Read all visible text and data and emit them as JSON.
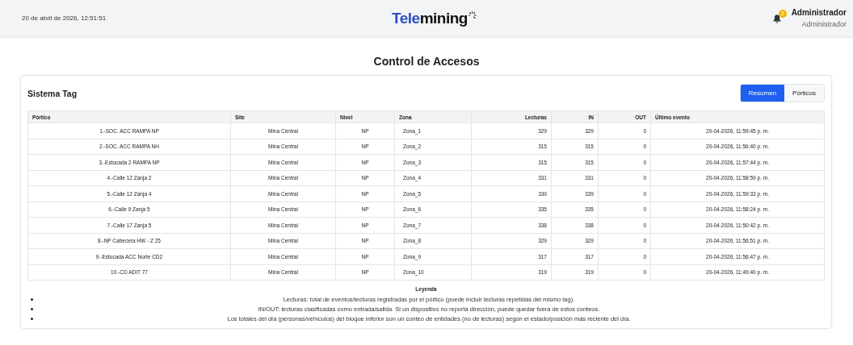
{
  "header": {
    "datetime": "20 de abril de 2026, 12:51:51",
    "logo": {
      "part_1": "Tele",
      "part_2": "mining"
    },
    "notifications": {
      "count": "2"
    },
    "user": {
      "name": "Administrador",
      "role": "Administrador"
    }
  },
  "page_title": "Control de Accesos",
  "card": {
    "title": "Sistema Tag",
    "view_buttons": [
      {
        "label": "Resumen",
        "selected": true
      },
      {
        "label": "Pórticos",
        "selected": false
      }
    ],
    "table": {
      "columns": [
        "Pórtico",
        "Site",
        "Nivel",
        "Zona",
        "Lecturas",
        "IN",
        "OUT",
        "Último evento"
      ],
      "rows": [
        [
          "1.-SOC. ACC RAMPA NP",
          "Mina Central",
          "NP",
          "Zona_1",
          "329",
          "329",
          "0",
          "20-04-2026, 11:59:45 p. m."
        ],
        [
          "2.-SOC. ACC RAMPA NH",
          "Mina Central",
          "NP",
          "Zona_2",
          "315",
          "315",
          "0",
          "20-04-2026, 11:56:40 p. m."
        ],
        [
          "3.-Estocada 2 RAMPA NP",
          "Mina Central",
          "NP",
          "Zona_3",
          "315",
          "315",
          "0",
          "20-04-2026, 11:57:44 p. m."
        ],
        [
          "4.-Calle 12 Zanja 2",
          "Mina Central",
          "NP",
          "Zona_4",
          "331",
          "331",
          "0",
          "20-04-2026, 11:58:59 p. m."
        ],
        [
          "5.-Calle 12 Zanja 4",
          "Mina Central",
          "NP",
          "Zona_5",
          "339",
          "339",
          "0",
          "20-04-2026, 11:59:33 p. m."
        ],
        [
          "6.-Calle 9 Zanja 5",
          "Mina Central",
          "NP",
          "Zona_6",
          "335",
          "335",
          "0",
          "20-04-2026, 11:58:24 p. m."
        ],
        [
          "7.-Calle 17 Zanja 5",
          "Mina Central",
          "NP",
          "Zona_7",
          "338",
          "338",
          "0",
          "20-04-2026, 11:50:42 p. m."
        ],
        [
          "8.-NP Cabecera HW - Z 25",
          "Mina Central",
          "NP",
          "Zona_8",
          "329",
          "329",
          "0",
          "20-04-2026, 11:56:51 p. m."
        ],
        [
          "9.-Estocada ACC Norte CD2",
          "Mina Central",
          "NP",
          "Zona_9",
          "317",
          "317",
          "0",
          "20-04-2026, 11:56:47 p. m."
        ],
        [
          "10.-CD ADIT 77",
          "Mina Central",
          "NP",
          "Zona_10",
          "319",
          "319",
          "0",
          "20-04-2026, 11:49:40 p. m."
        ]
      ]
    },
    "legend": {
      "title": "Leyenda",
      "items": [
        "Lecturas: total de eventos/lecturas registradas por el pórtico (puede incluir lecturas repetidas del mismo tag).",
        "IN/OUT: lecturas clasificadas como entrada/salida. Si un dispositivo no reporta dirección, puede quedar fuera de estos conteos.",
        "Los totales del día (personas/vehículos) del bloque inferior son un conteo de entidades (no de lecturas) según el estado/posición más reciente del día."
      ]
    }
  }
}
